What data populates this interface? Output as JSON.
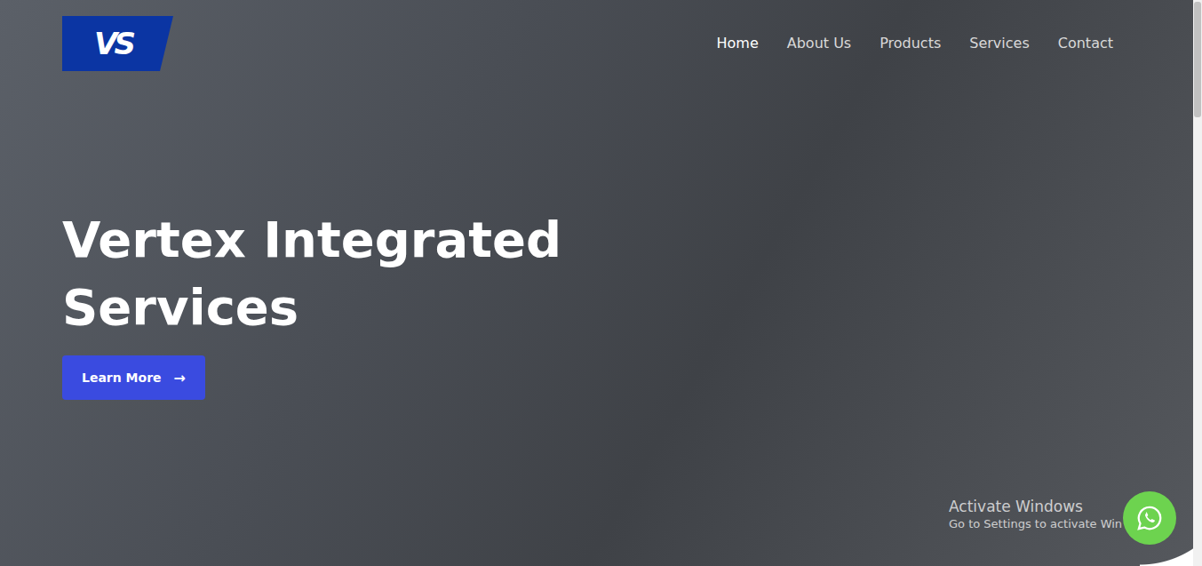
{
  "logo": {
    "text": "VS"
  },
  "nav": [
    {
      "label": "Home",
      "selected": true
    },
    {
      "label": "About Us",
      "selected": false
    },
    {
      "label": "Products",
      "selected": false
    },
    {
      "label": "Services",
      "selected": false
    },
    {
      "label": "Contact",
      "selected": false
    }
  ],
  "hero": {
    "title": "Vertex Integrated Services",
    "button": {
      "label": "Learn More",
      "arrow": "→"
    }
  },
  "watermark": {
    "line1": "Activate Windows",
    "line2": "Go to Settings to activate Win"
  }
}
